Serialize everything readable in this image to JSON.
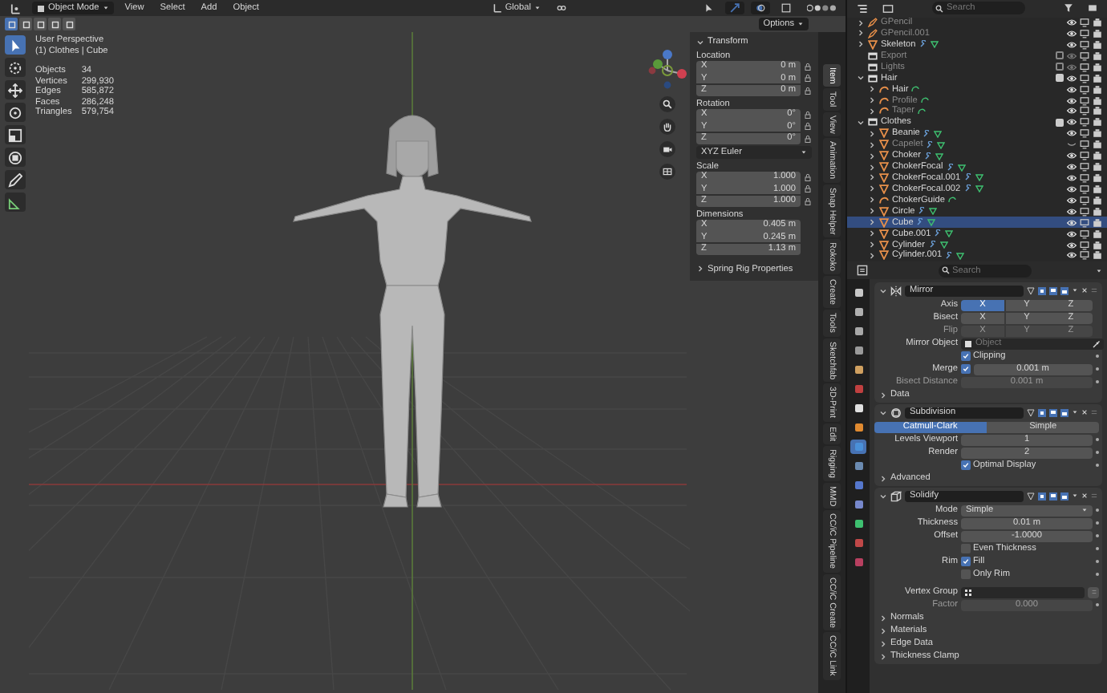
{
  "header": {
    "mode": "Object Mode",
    "menus": [
      "View",
      "Select",
      "Add",
      "Object"
    ],
    "orientation": "Global",
    "options": "Options",
    "gizmos_on": true,
    "overlays_on": true,
    "xray_on": false
  },
  "tools": [
    {
      "kind": "select",
      "selected": true
    },
    {
      "kind": "cursor",
      "selected": false
    },
    {
      "kind": "move",
      "selected": false
    },
    {
      "kind": "rotate",
      "selected": false
    },
    {
      "kind": "scale",
      "selected": false
    },
    {
      "kind": "transform",
      "selected": false
    },
    {
      "kind": "annotate",
      "selected": false
    },
    {
      "kind": "measure",
      "selected": false
    }
  ],
  "viewport": {
    "view_name": "User Perspective",
    "context": "(1) Clothes | Cube",
    "stats": [
      {
        "label": "Objects",
        "value": "34"
      },
      {
        "label": "Vertices",
        "value": "299,930"
      },
      {
        "label": "Edges",
        "value": "585,872"
      },
      {
        "label": "Faces",
        "value": "286,248"
      },
      {
        "label": "Triangles",
        "value": "579,754"
      }
    ]
  },
  "sidebar": {
    "transform": {
      "title": "Transform",
      "expanded": true,
      "groups": [
        {
          "label": "Location",
          "fields": [
            {
              "axis": "X",
              "value": "0 m"
            },
            {
              "axis": "Y",
              "value": "0 m"
            },
            {
              "axis": "Z",
              "value": "0 m"
            }
          ],
          "locks": true
        },
        {
          "label": "Rotation",
          "fields": [
            {
              "axis": "X",
              "value": "0°"
            },
            {
              "axis": "Y",
              "value": "0°"
            },
            {
              "axis": "Z",
              "value": "0°"
            }
          ],
          "locks": true,
          "mode": "XYZ Euler"
        },
        {
          "label": "Scale",
          "fields": [
            {
              "axis": "X",
              "value": "1.000"
            },
            {
              "axis": "Y",
              "value": "1.000"
            },
            {
              "axis": "Z",
              "value": "1.000"
            }
          ],
          "locks": true
        },
        {
          "label": "Dimensions",
          "fields": [
            {
              "axis": "X",
              "value": "0.405 m"
            },
            {
              "axis": "Y",
              "value": "0.245 m"
            },
            {
              "axis": "Z",
              "value": "1.13 m"
            }
          ],
          "locks": false
        }
      ]
    },
    "sections": [
      {
        "title": "Spring Rig Properties",
        "expanded": false
      }
    ],
    "tabs": [
      {
        "label": "Item",
        "selected": true
      },
      {
        "label": "Tool",
        "selected": false
      },
      {
        "label": "View",
        "selected": false
      },
      {
        "label": "Animation",
        "selected": false
      },
      {
        "label": "Snap Helper",
        "selected": false
      },
      {
        "label": "Rokoko",
        "selected": false
      },
      {
        "label": "Create",
        "selected": false
      },
      {
        "label": "Tools",
        "selected": false
      },
      {
        "label": "Sketchfab",
        "selected": false
      },
      {
        "label": "3D-Print",
        "selected": false
      },
      {
        "label": "Edit",
        "selected": false
      },
      {
        "label": "Rigging",
        "selected": false
      },
      {
        "label": "MMD",
        "selected": false
      },
      {
        "label": "CC/iC Pipeline",
        "selected": false
      },
      {
        "label": "CC/iC Create",
        "selected": false
      },
      {
        "label": "CC/iC Link",
        "selected": false
      }
    ]
  },
  "outliner": {
    "search_placeholder": "Search",
    "items": [
      {
        "label": "GPencil",
        "kind": "gpencil",
        "disabled": true,
        "hidden": false,
        "selected": false
      },
      {
        "label": "GPencil.001",
        "kind": "gpencil",
        "disabled": true,
        "hidden": false,
        "selected": false
      },
      {
        "label": "Skeleton",
        "kind": "mesh",
        "disabled": false,
        "hidden": false,
        "selected": false
      },
      {
        "label": "Export",
        "kind": "collection",
        "included": false,
        "disabled": true,
        "hidden": false,
        "selected": false
      },
      {
        "label": "Lights",
        "kind": "collection",
        "included": false,
        "disabled": true,
        "hidden": false,
        "selected": false
      },
      {
        "label": "Hair",
        "kind": "collection",
        "expanded": true,
        "included": true,
        "disabled": false,
        "hidden": false,
        "selected": false,
        "children": [
          {
            "label": "Hair",
            "kind": "curve",
            "disabled": false,
            "hidden": false,
            "selected": false
          },
          {
            "label": "Profile",
            "kind": "curve",
            "disabled": true,
            "hidden": false,
            "selected": false
          },
          {
            "label": "Taper",
            "kind": "curve",
            "disabled": true,
            "hidden": false,
            "selected": false
          }
        ]
      },
      {
        "label": "Clothes",
        "kind": "collection",
        "expanded": true,
        "included": true,
        "disabled": false,
        "hidden": false,
        "selected": false,
        "children": [
          {
            "label": "Beanie",
            "kind": "mesh",
            "disabled": false,
            "hidden": false,
            "selected": false
          },
          {
            "label": "Capelet",
            "kind": "mesh",
            "disabled": true,
            "hidden": true,
            "selected": false
          },
          {
            "label": "Choker",
            "kind": "mesh",
            "disabled": false,
            "hidden": false,
            "selected": false
          },
          {
            "label": "ChokerFocal",
            "kind": "mesh",
            "disabled": false,
            "hidden": false,
            "selected": false
          },
          {
            "label": "ChokerFocal.001",
            "kind": "mesh",
            "disabled": false,
            "hidden": false,
            "selected": false
          },
          {
            "label": "ChokerFocal.002",
            "kind": "mesh",
            "disabled": false,
            "hidden": false,
            "selected": false
          },
          {
            "label": "ChokerGuide",
            "kind": "curve",
            "disabled": false,
            "hidden": false,
            "selected": false
          },
          {
            "label": "Circle",
            "kind": "mesh",
            "disabled": false,
            "hidden": false,
            "selected": false
          },
          {
            "label": "Cube",
            "kind": "mesh",
            "disabled": false,
            "hidden": false,
            "selected": true
          },
          {
            "label": "Cube.001",
            "kind": "mesh",
            "disabled": false,
            "hidden": false,
            "selected": false
          },
          {
            "label": "Cylinder",
            "kind": "mesh",
            "disabled": false,
            "hidden": false,
            "selected": false
          },
          {
            "label": "Cylinder.001",
            "kind": "mesh",
            "disabled": false,
            "hidden": false,
            "selected": false
          }
        ]
      }
    ]
  },
  "properties": {
    "search_placeholder": "Search",
    "tabs": [
      {
        "color": "#c8c8c8",
        "selected": false
      },
      {
        "color": "#b0b0b0",
        "selected": false
      },
      {
        "color": "#a8a8a8",
        "selected": false
      },
      {
        "color": "#9a9a9a",
        "selected": false
      },
      {
        "color": "#d0a060",
        "selected": false
      },
      {
        "color": "#c04040",
        "selected": false
      },
      {
        "color": "#e0e0e0",
        "selected": false
      },
      {
        "color": "#e08a30",
        "selected": false
      },
      {
        "color": "#4a90d9",
        "selected": true
      },
      {
        "color": "#6a8ab0",
        "selected": false
      },
      {
        "color": "#5577cc",
        "selected": false
      },
      {
        "color": "#7788cc",
        "selected": false
      },
      {
        "color": "#3ec070",
        "selected": false
      },
      {
        "color": "#c04848",
        "selected": false
      },
      {
        "color": "#b84060",
        "selected": false
      }
    ],
    "modifiers": [
      {
        "kind": "mirror",
        "name": "Mirror",
        "expanded": true,
        "rows": [
          {
            "kind": "segmented",
            "label": "Axis",
            "disabled": false,
            "options": [
              {
                "label": "X",
                "selected": true
              },
              {
                "label": "Y",
                "selected": false
              },
              {
                "label": "Z",
                "selected": false
              }
            ]
          },
          {
            "kind": "segmented",
            "label": "Bisect",
            "disabled": false,
            "options": [
              {
                "label": "X",
                "selected": false
              },
              {
                "label": "Y",
                "selected": false
              },
              {
                "label": "Z",
                "selected": false
              }
            ]
          },
          {
            "kind": "segmented",
            "label": "Flip",
            "disabled": true,
            "options": [
              {
                "label": "X",
                "selected": false
              },
              {
                "label": "Y",
                "selected": false
              },
              {
                "label": "Z",
                "selected": false
              }
            ]
          },
          {
            "kind": "picker",
            "label": "Mirror Object",
            "placeholder": "Object"
          },
          {
            "kind": "checkbox",
            "text": "Clipping",
            "checked": true
          },
          {
            "kind": "checkfield",
            "label": "Merge",
            "checked": true,
            "value": "0.001 m"
          },
          {
            "kind": "field",
            "label": "Bisect Distance",
            "value": "0.001 m",
            "disabled": true
          },
          {
            "kind": "subsection",
            "title": "Data",
            "expanded": false
          }
        ]
      },
      {
        "kind": "subdivision",
        "name": "Subdivision",
        "expanded": true,
        "rows": [
          {
            "kind": "segmented",
            "disabled": false,
            "options": [
              {
                "label": "Catmull-Clark",
                "selected": true
              },
              {
                "label": "Simple",
                "selected": false
              }
            ]
          },
          {
            "kind": "field",
            "label": "Levels Viewport",
            "value": "1",
            "disabled": false
          },
          {
            "kind": "field",
            "label": "Render",
            "value": "2",
            "disabled": false
          },
          {
            "kind": "checkbox",
            "text": "Optimal Display",
            "checked": true
          },
          {
            "kind": "subsection",
            "title": "Advanced",
            "expanded": false
          }
        ]
      },
      {
        "kind": "solidify",
        "name": "Solidify",
        "expanded": true,
        "rows": [
          {
            "kind": "dropdown",
            "label": "Mode",
            "value": "Simple"
          },
          {
            "kind": "field",
            "label": "Thickness",
            "value": "0.01 m",
            "disabled": false
          },
          {
            "kind": "field",
            "label": "Offset",
            "value": "-1.0000",
            "disabled": false
          },
          {
            "kind": "checkbox",
            "text": "Even Thickness",
            "checked": false
          },
          {
            "kind": "checkbox",
            "label": "Rim",
            "text": "Fill",
            "checked": true
          },
          {
            "kind": "checkbox",
            "text": "Only Rim",
            "checked": false
          },
          {
            "kind": "group",
            "label": "Vertex Group"
          },
          {
            "kind": "field",
            "label": "Factor",
            "value": "0.000",
            "disabled": true
          },
          {
            "kind": "subsection",
            "title": "Normals",
            "expanded": false
          },
          {
            "kind": "subsection",
            "title": "Materials",
            "expanded": false
          },
          {
            "kind": "subsection",
            "title": "Edge Data",
            "expanded": false
          },
          {
            "kind": "subsection",
            "title": "Thickness Clamp",
            "expanded": false
          }
        ]
      }
    ]
  }
}
